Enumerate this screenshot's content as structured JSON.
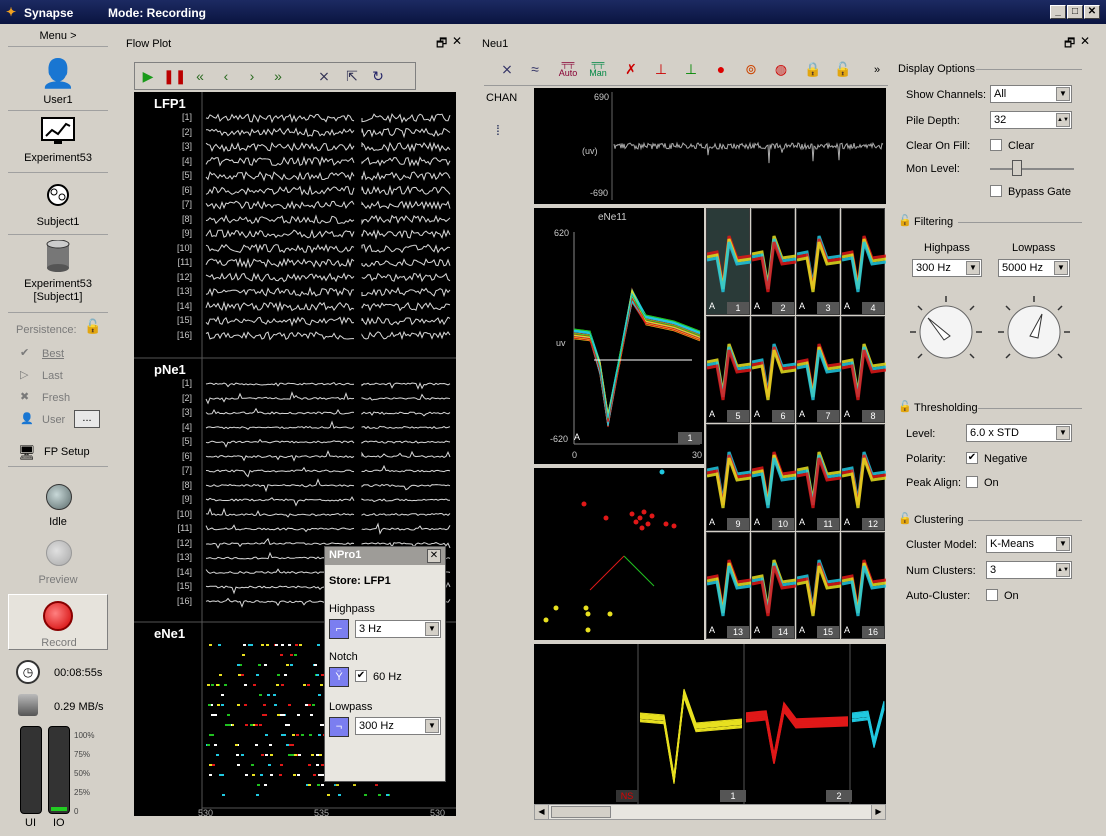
{
  "app": {
    "title": "Synapse",
    "mode": "Mode: Recording"
  },
  "nav": {
    "menu": "Menu >",
    "user": "User1",
    "experiment": "Experiment53",
    "subject": "Subject1",
    "block_line1": "Experiment53",
    "block_line2": "[Subject1]",
    "persistence": "Persistence:",
    "best": "Best",
    "last": "Last",
    "fresh": "Fresh",
    "user_p": "User",
    "ellipsis": "...",
    "fp_setup": "FP Setup",
    "idle": "Idle",
    "preview": "Preview",
    "record": "Record",
    "elapsed": "00:08:55s",
    "rate": "0.29 MB/s",
    "meter_labels": [
      "100%",
      "75%",
      "50%",
      "25%",
      "0"
    ],
    "ui": "UI",
    "io": "IO"
  },
  "flowplot": {
    "title": "Flow Plot",
    "lfp": "LFP1",
    "pne": "pNe1",
    "ene": "eNe1",
    "channels": [
      "[1]",
      "[2]",
      "[3]",
      "[4]",
      "[5]",
      "[6]",
      "[7]",
      "[8]",
      "[9]",
      "[10]",
      "[11]",
      "[12]",
      "[13]",
      "[14]",
      "[15]",
      "[16]"
    ],
    "xticks": [
      "530",
      "535",
      "530"
    ]
  },
  "npro": {
    "title": "NPro1",
    "store": "Store:  LFP1",
    "highpass": "Highpass",
    "hp_val": "3 Hz",
    "notch": "Notch",
    "notch_val": "60 Hz",
    "lowpass": "Lowpass",
    "lp_val": "300 Hz"
  },
  "neu": {
    "title": "Neu1",
    "chan": "CHAN",
    "auto": "Auto",
    "man": "Man",
    "channels": [
      "1",
      "2",
      "3",
      "4",
      "5",
      "6",
      "7",
      "8",
      "9",
      "10",
      "11",
      "12",
      "13",
      "14",
      "15",
      "16"
    ],
    "top_ymax": "690",
    "top_ymin": "-690",
    "top_unit": "(uv)",
    "main_name": "eNe11",
    "main_ymax": "620",
    "main_ymin": "-620",
    "main_unit": "uv",
    "main_x0": "0",
    "main_x1": "30",
    "main_corner": "1",
    "grid_nums": [
      "1",
      "2",
      "3",
      "4",
      "5",
      "6",
      "7",
      "8",
      "9",
      "10",
      "11",
      "12",
      "13",
      "14",
      "15",
      "16"
    ],
    "bottom_nums": [
      "NS",
      "1",
      "2"
    ],
    "a_label": "A"
  },
  "display": {
    "title": "Display Options",
    "show_channels": "Show Channels:",
    "show_val": "All",
    "pile_depth": "Pile Depth:",
    "pile_val": "32",
    "clear_on_fill": "Clear On Fill:",
    "clear": "Clear",
    "mon_level": "Mon Level:",
    "bypass": "Bypass Gate",
    "filtering": "Filtering",
    "highpass": "Highpass",
    "lowpass": "Lowpass",
    "hp_val": "300 Hz",
    "lp_val": "5000 Hz",
    "thresholding": "Thresholding",
    "level": "Level:",
    "level_val": "6.0 x STD",
    "polarity": "Polarity:",
    "negative": "Negative",
    "peak_align": "Peak Align:",
    "on": "On",
    "clustering": "Clustering",
    "cluster_model": "Cluster Model:",
    "model_val": "K-Means",
    "num_clusters": "Num Clusters:",
    "num_val": "3",
    "auto_cluster": "Auto-Cluster:",
    "on2": "On"
  },
  "colors": {
    "accent": "#6a6cf0",
    "red": "#e01818",
    "yellow": "#e8e020",
    "green": "#20c020",
    "cyan": "#20c8e0"
  }
}
